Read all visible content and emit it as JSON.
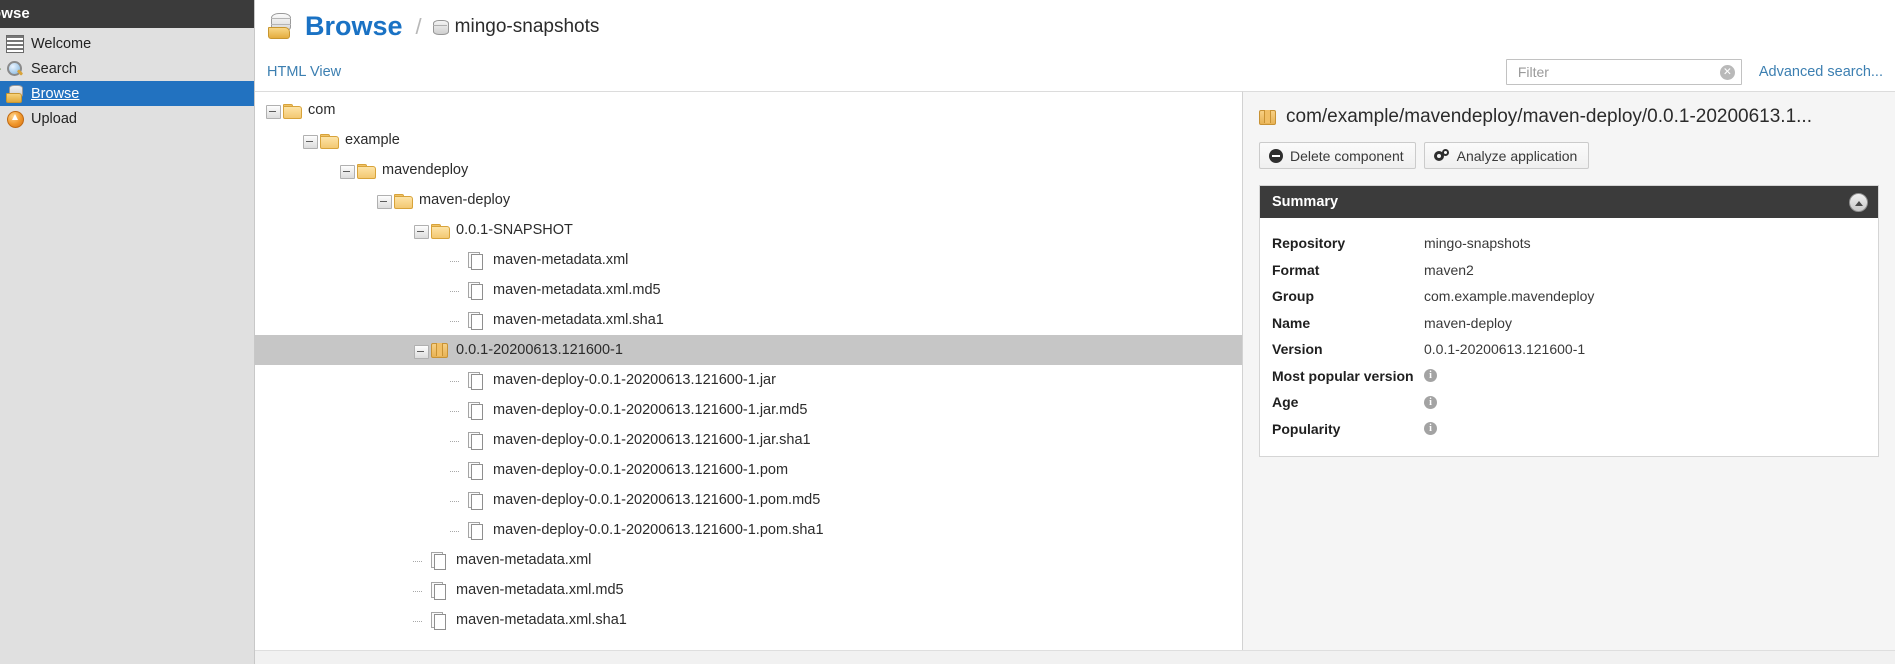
{
  "sidebar": {
    "header": "rowse",
    "items": [
      {
        "label": "Welcome",
        "icon": "welcome-icon",
        "twisty": "",
        "selected": false
      },
      {
        "label": "Search",
        "icon": "search-icon",
        "twisty": "+",
        "selected": false
      },
      {
        "label": "Browse",
        "icon": "browse-icon",
        "twisty": "",
        "selected": true
      },
      {
        "label": "Upload",
        "icon": "upload-icon",
        "twisty": "",
        "selected": false
      }
    ]
  },
  "header": {
    "title": "Browse",
    "separator": "/",
    "repository": "mingo-snapshots",
    "title_color": "#1a72c4"
  },
  "toolbar": {
    "html_view": "HTML View",
    "filter_value": "",
    "filter_placeholder": "Filter",
    "clear_icon": "✕",
    "advanced_search": "Advanced search..."
  },
  "tree": [
    {
      "label": "com",
      "depth": 0,
      "icon": "folder-icon",
      "toggle": "minus",
      "selected": false
    },
    {
      "label": "example",
      "depth": 1,
      "icon": "folder-icon",
      "toggle": "minus",
      "selected": false
    },
    {
      "label": "mavendeploy",
      "depth": 2,
      "icon": "folder-icon",
      "toggle": "minus",
      "selected": false
    },
    {
      "label": "maven-deploy",
      "depth": 3,
      "icon": "folder-icon",
      "toggle": "minus",
      "selected": false
    },
    {
      "label": "0.0.1-SNAPSHOT",
      "depth": 4,
      "icon": "folder-icon",
      "toggle": "minus",
      "selected": false
    },
    {
      "label": "maven-metadata.xml",
      "depth": 5,
      "icon": "file-icon",
      "toggle": "leaf",
      "selected": false
    },
    {
      "label": "maven-metadata.xml.md5",
      "depth": 5,
      "icon": "file-icon",
      "toggle": "leaf",
      "selected": false
    },
    {
      "label": "maven-metadata.xml.sha1",
      "depth": 5,
      "icon": "file-icon",
      "toggle": "leaf",
      "selected": false
    },
    {
      "label": "0.0.1-20200613.121600-1",
      "depth": 4,
      "icon": "package-icon",
      "toggle": "minus",
      "selected": true
    },
    {
      "label": "maven-deploy-0.0.1-20200613.121600-1.jar",
      "depth": 5,
      "icon": "file-icon",
      "toggle": "leaf",
      "selected": false
    },
    {
      "label": "maven-deploy-0.0.1-20200613.121600-1.jar.md5",
      "depth": 5,
      "icon": "file-icon",
      "toggle": "leaf",
      "selected": false
    },
    {
      "label": "maven-deploy-0.0.1-20200613.121600-1.jar.sha1",
      "depth": 5,
      "icon": "file-icon",
      "toggle": "leaf",
      "selected": false
    },
    {
      "label": "maven-deploy-0.0.1-20200613.121600-1.pom",
      "depth": 5,
      "icon": "file-icon",
      "toggle": "leaf",
      "selected": false
    },
    {
      "label": "maven-deploy-0.0.1-20200613.121600-1.pom.md5",
      "depth": 5,
      "icon": "file-icon",
      "toggle": "leaf",
      "selected": false
    },
    {
      "label": "maven-deploy-0.0.1-20200613.121600-1.pom.sha1",
      "depth": 5,
      "icon": "file-icon",
      "toggle": "leaf",
      "selected": false
    },
    {
      "label": "maven-metadata.xml",
      "depth": 4,
      "icon": "file-icon",
      "toggle": "leaf",
      "selected": false
    },
    {
      "label": "maven-metadata.xml.md5",
      "depth": 4,
      "icon": "file-icon",
      "toggle": "leaf",
      "selected": false
    },
    {
      "label": "maven-metadata.xml.sha1",
      "depth": 4,
      "icon": "file-icon",
      "toggle": "leaf",
      "selected": false
    }
  ],
  "detail": {
    "title": "com/example/mavendeploy/maven-deploy/0.0.1-20200613.1...",
    "buttons": [
      {
        "label": "Delete component",
        "icon": "minus-circle-icon"
      },
      {
        "label": "Analyze application",
        "icon": "gears-icon"
      }
    ],
    "summary": {
      "heading": "Summary",
      "rows": [
        {
          "key": "Repository",
          "value": "mingo-snapshots",
          "info": false
        },
        {
          "key": "Format",
          "value": "maven2",
          "info": false
        },
        {
          "key": "Group",
          "value": "com.example.mavendeploy",
          "info": false
        },
        {
          "key": "Name",
          "value": "maven-deploy",
          "info": false
        },
        {
          "key": "Version",
          "value": "0.0.1-20200613.121600-1",
          "info": false
        },
        {
          "key": "Most popular version",
          "value": "",
          "info": true
        },
        {
          "key": "Age",
          "value": "",
          "info": true
        },
        {
          "key": "Popularity",
          "value": "",
          "info": true
        }
      ],
      "info_glyph": "i"
    }
  }
}
